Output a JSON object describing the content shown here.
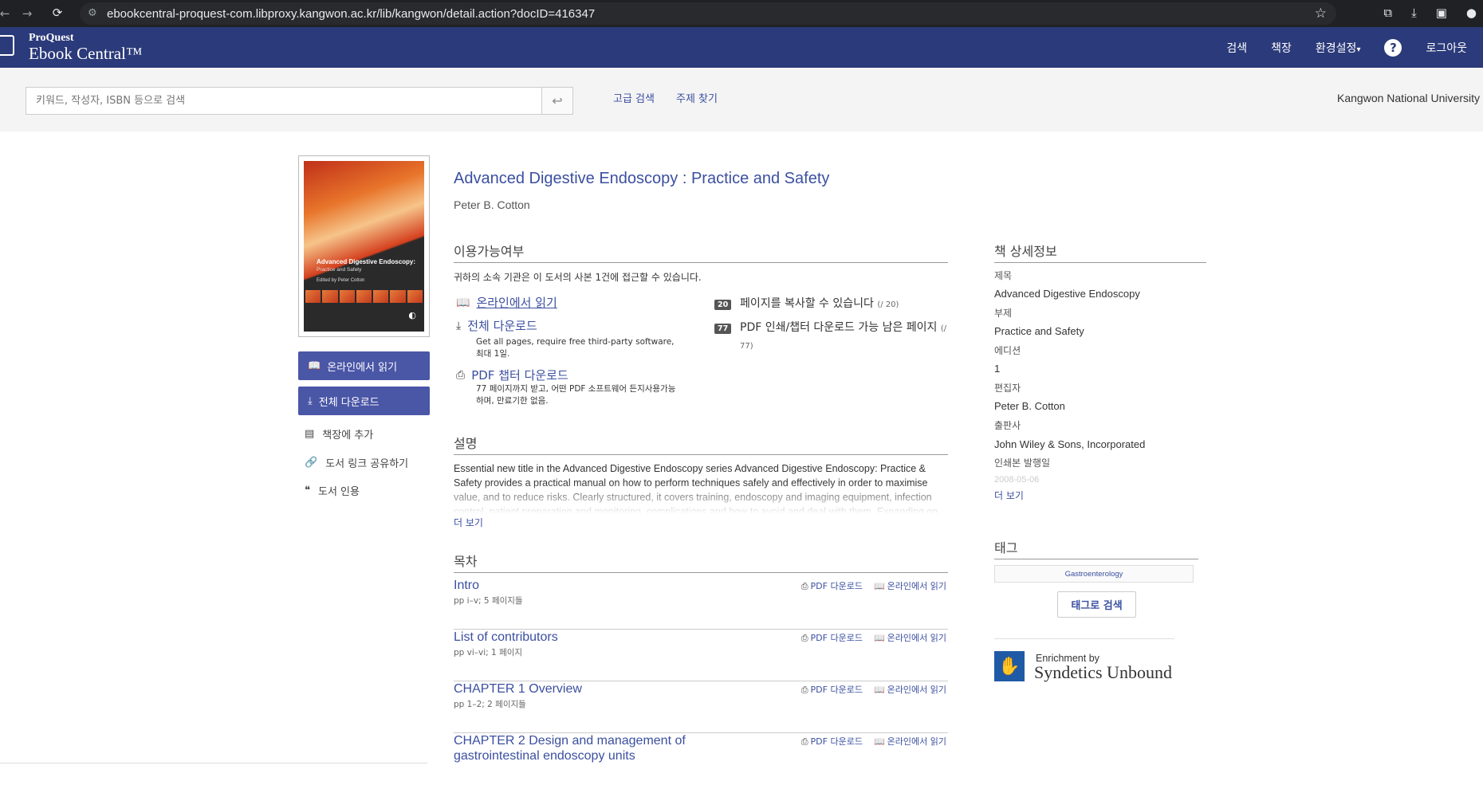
{
  "browser": {
    "back": "←",
    "forward": "→",
    "reload": "⟳",
    "url": "ebookcentral-proquest-com.libproxy.kangwon.ac.kr/lib/kangwon/detail.action?docID=416347",
    "star": "☆"
  },
  "header": {
    "logo_small": "ProQuest",
    "logo_big": "Ebook Central™",
    "nav": {
      "search": "검색",
      "bookshelf": "책장",
      "settings": "환경설정",
      "settings_caret": "▾",
      "help": "?",
      "logout": "로그아웃"
    }
  },
  "search": {
    "placeholder": "키워드, 작성자, ISBN 등으로 검색",
    "go": "↩",
    "advanced": "고급 검색",
    "browse": "주제 찾기",
    "institution": "Kangwon National University"
  },
  "cover": {
    "title": "Advanced Digestive Endoscopy:",
    "subtitle": "Practice and Safety",
    "editor": "Edited by Peter Cotton"
  },
  "left": {
    "read_online": "온라인에서 읽기",
    "download_full": "전체 다운로드",
    "add_bookshelf": "책장에 추가",
    "share_link": "도서 링크 공유하기",
    "cite": "도서 인용"
  },
  "book": {
    "title": "Advanced Digestive Endoscopy : Practice and Safety",
    "author": "Peter B. Cotton"
  },
  "availability": {
    "heading": "이용가능여부",
    "note": "귀하의 소속 기관은 이 도서의 사본 1건에 접근할 수 있습니다.",
    "read_online": "온라인에서 읽기",
    "full_download": "전체 다운로드",
    "full_download_note": "Get all pages, require free third-party software, 최대 1일.",
    "pdf_chapter": "PDF 챕터 다운로드",
    "pdf_chapter_note": "77 페이지까지 받고, 어떤 PDF 소프트웨어 든지사용가능하며, 만료기한 없음.",
    "copy_count": "20",
    "copy_text": "페이지를 복사할 수 있습니다",
    "copy_total": "(/ 20)",
    "print_count": "77",
    "print_text": "PDF 인쇄/챕터 다운로드 가능 남은 페이지",
    "print_total": "(/ 77)"
  },
  "description": {
    "heading": "설명",
    "text": "Essential new title in the Advanced Digestive Endoscopy series Advanced Digestive Endoscopy: Practice & Safety provides a practical manual on how to perform techniques safely and effectively in order to maximise value, and to reduce risks. Clearly structured, it covers training, endoscopy and imaging equipment, infection control, patient preparation and monitoring, complications and how to avoid and deal with them. Expanding on",
    "more": "더 보기"
  },
  "toc": {
    "heading": "목차",
    "pdf_label": "PDF 다운로드",
    "read_label": "온라인에서 읽기",
    "rows": [
      {
        "title": "Intro",
        "pages": "pp i–v; 5 페이지들"
      },
      {
        "title": "List of contributors",
        "pages": "pp vi–vi; 1 페이지"
      },
      {
        "title": "CHAPTER 1 Overview",
        "pages": "pp 1–2; 2 페이지들"
      },
      {
        "title": "CHAPTER 2 Design and management of gastrointestinal endoscopy units",
        "pages": ""
      }
    ]
  },
  "details": {
    "heading": "책 상세정보",
    "title_label": "제목",
    "title_value": "Advanced Digestive Endoscopy",
    "subtitle_label": "부제",
    "subtitle_value": "Practice and Safety",
    "edition_label": "에디션",
    "edition_value": "1",
    "editor_label": "편집자",
    "editor_value": "Peter B. Cotton",
    "publisher_label": "출판사",
    "publisher_value": "John Wiley & Sons, Incorporated",
    "print_date_label": "인쇄본 발행일",
    "print_date_value": "2008-05-06",
    "more": "더 보기"
  },
  "tags": {
    "heading": "태그",
    "tag": "Gastroenterology",
    "search_btn": "태그로 검색"
  },
  "syndetics": {
    "small": "Enrichment by",
    "big": "Syndetics Unbound"
  }
}
